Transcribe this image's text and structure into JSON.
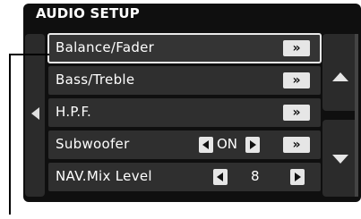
{
  "title": "AUDIO SETUP",
  "menu": [
    {
      "label": "Balance/Fader",
      "action": "»",
      "selected": true
    },
    {
      "label": "Bass/Treble",
      "action": "»"
    },
    {
      "label": "H.P.F.",
      "action": "»"
    },
    {
      "label": "Subwoofer",
      "value": "ON",
      "action": "»"
    },
    {
      "label": "NAV.Mix Level",
      "value": "8"
    }
  ],
  "icons": {
    "back": "left-triangle",
    "scroll_up": "up-triangle",
    "scroll_down": "down-triangle",
    "prev": "left-triangle",
    "next": "right-triangle"
  },
  "colors": {
    "screen_bg": "#0f0f0f",
    "row_bg": "#2f2f2f",
    "button_bg": "#e6e6e6",
    "text": "#ffffff"
  }
}
